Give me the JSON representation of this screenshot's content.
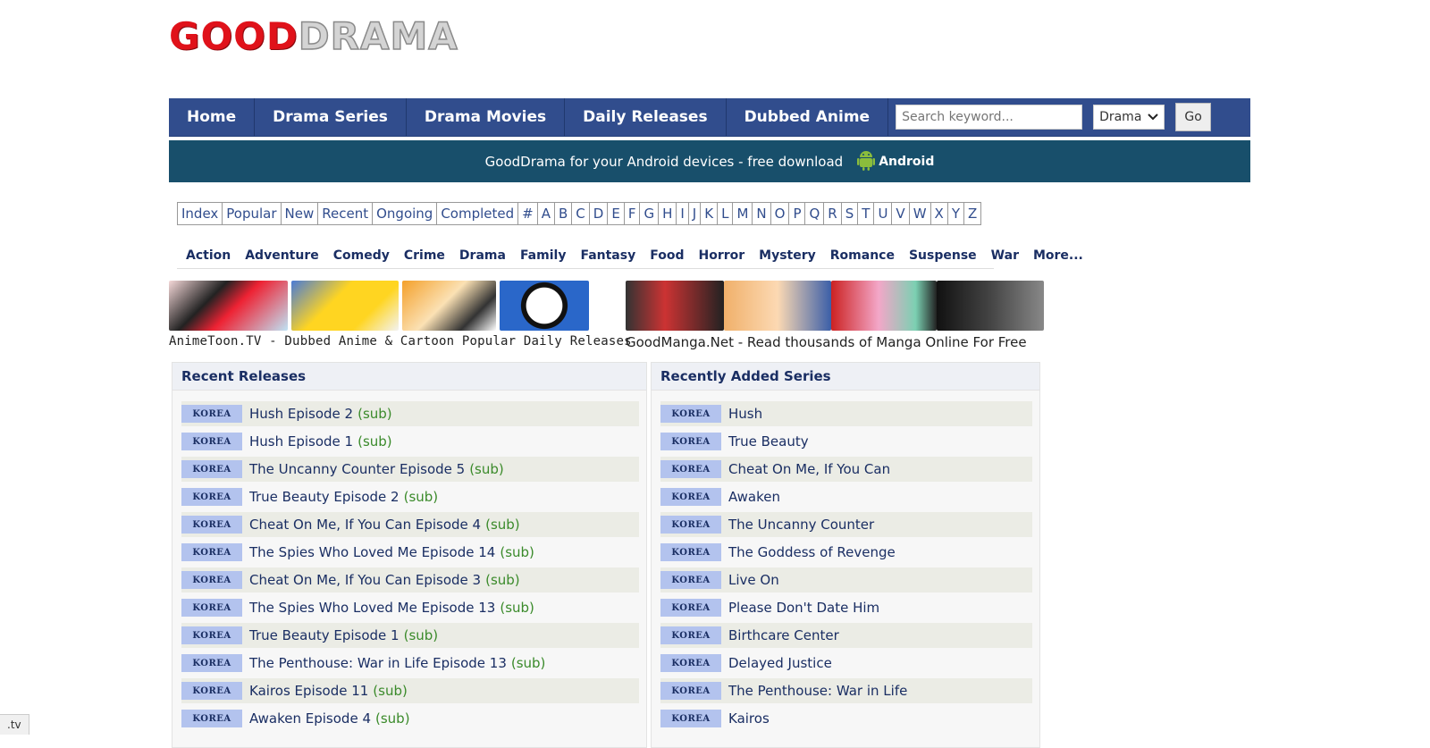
{
  "logo": {
    "good": "GOOD",
    "drama": "DRAMA"
  },
  "nav": {
    "items": [
      "Home",
      "Drama Series",
      "Drama Movies",
      "Daily Releases",
      "Dubbed Anime"
    ],
    "search_placeholder": "Search keyword...",
    "select_value": "Drama",
    "go_label": "Go"
  },
  "android_bar": {
    "text": "GoodDrama for your Android devices - free download",
    "badge": "Android"
  },
  "alpha_index": [
    "Index",
    "Popular",
    "New",
    "Recent",
    "Ongoing",
    "Completed",
    "#",
    "A",
    "B",
    "C",
    "D",
    "E",
    "F",
    "G",
    "H",
    "I",
    "J",
    "K",
    "L",
    "M",
    "N",
    "O",
    "P",
    "Q",
    "R",
    "S",
    "T",
    "U",
    "V",
    "W",
    "X",
    "Y",
    "Z"
  ],
  "genres": [
    "Action",
    "Adventure",
    "Comedy",
    "Crime",
    "Drama",
    "Family",
    "Fantasy",
    "Food",
    "Horror",
    "Mystery",
    "Romance",
    "Suspense",
    "War",
    "More..."
  ],
  "banners": {
    "left_caption": "AnimeToon.TV - Dubbed Anime & Cartoon Popular Daily Releases",
    "right_caption": "GoodManga.Net - Read thousands of Manga Online For Free"
  },
  "recent_releases": {
    "title": "Recent Releases",
    "tag": "KOREA",
    "items": [
      {
        "title": "Hush Episode 2",
        "suffix": "(sub)"
      },
      {
        "title": "Hush Episode 1",
        "suffix": "(sub)"
      },
      {
        "title": "The Uncanny Counter Episode 5",
        "suffix": "(sub)"
      },
      {
        "title": "True Beauty Episode 2",
        "suffix": "(sub)"
      },
      {
        "title": "Cheat On Me, If You Can Episode 4",
        "suffix": "(sub)"
      },
      {
        "title": "The Spies Who Loved Me Episode 14",
        "suffix": "(sub)"
      },
      {
        "title": "Cheat On Me, If You Can Episode 3",
        "suffix": "(sub)"
      },
      {
        "title": "The Spies Who Loved Me Episode 13",
        "suffix": "(sub)"
      },
      {
        "title": "True Beauty Episode 1",
        "suffix": "(sub)"
      },
      {
        "title": "The Penthouse: War in Life Episode 13",
        "suffix": "(sub)"
      },
      {
        "title": "Kairos Episode 11",
        "suffix": "(sub)"
      },
      {
        "title": "Awaken Episode 4",
        "suffix": "(sub)"
      }
    ]
  },
  "recently_added": {
    "title": "Recently Added Series",
    "tag": "KOREA",
    "items": [
      "Hush",
      "True Beauty",
      "Cheat On Me, If You Can",
      "Awaken",
      "The Uncanny Counter",
      "The Goddess of Revenge",
      "Live On",
      "Please Don't Date Him",
      "Birthcare Center",
      "Delayed Justice",
      "The Penthouse: War in Life",
      "Kairos"
    ]
  },
  "status_bar": {
    "text": ".tv"
  },
  "colors": {
    "nav": "#314d8d",
    "android_bar": "#184f6b",
    "tag": "#b3c3ee",
    "sub": "#3a8a2a",
    "link": "#1a2e63"
  }
}
